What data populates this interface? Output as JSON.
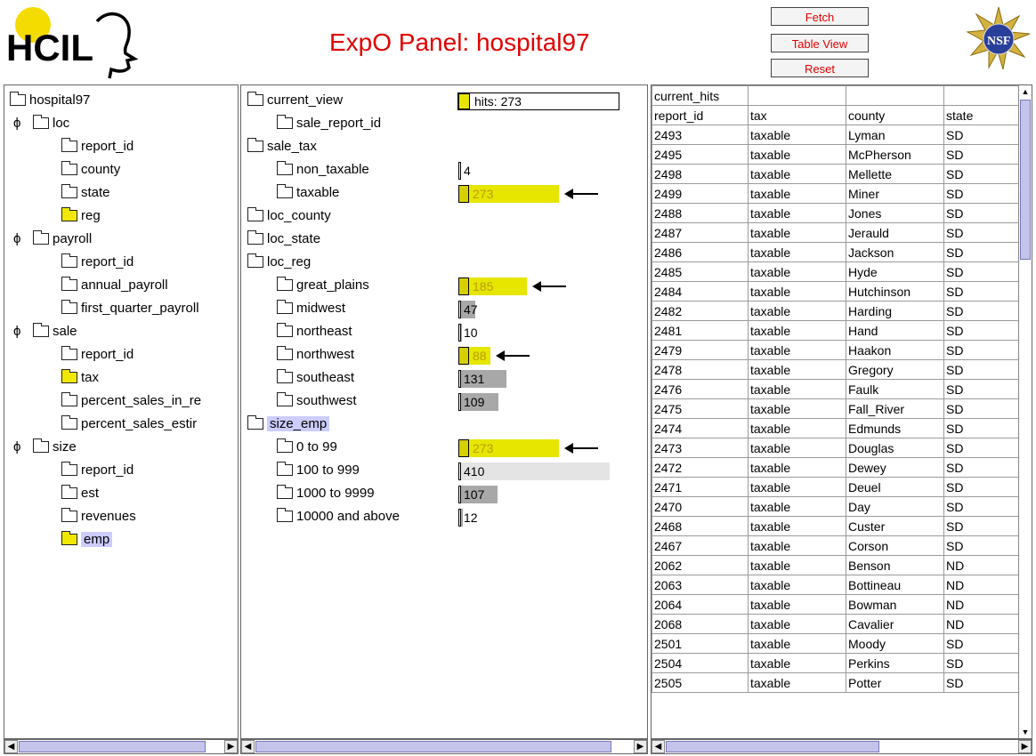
{
  "header": {
    "logo_text": "HCIL",
    "title": "ExpO Panel: hospital97",
    "buttons": [
      "Fetch",
      "Table View",
      "Reset"
    ],
    "nsf_text": "NSF"
  },
  "schema_tree": {
    "root": "hospital97",
    "items": [
      {
        "label": "hospital97",
        "level": 0,
        "key": false,
        "color": "white"
      },
      {
        "label": "loc",
        "level": 1,
        "key": true,
        "color": "white"
      },
      {
        "label": "report_id",
        "level": 2,
        "key": false,
        "color": "white"
      },
      {
        "label": "county",
        "level": 2,
        "key": false,
        "color": "white"
      },
      {
        "label": "state",
        "level": 2,
        "key": false,
        "color": "white"
      },
      {
        "label": "reg",
        "level": 2,
        "key": false,
        "color": "yellow"
      },
      {
        "label": "payroll",
        "level": 1,
        "key": true,
        "color": "white"
      },
      {
        "label": "report_id",
        "level": 2,
        "key": false,
        "color": "white"
      },
      {
        "label": "annual_payroll",
        "level": 2,
        "key": false,
        "color": "white"
      },
      {
        "label": "first_quarter_payroll",
        "level": 2,
        "key": false,
        "color": "white"
      },
      {
        "label": "sale",
        "level": 1,
        "key": true,
        "color": "white"
      },
      {
        "label": "report_id",
        "level": 2,
        "key": false,
        "color": "white"
      },
      {
        "label": "tax",
        "level": 2,
        "key": false,
        "color": "yellow"
      },
      {
        "label": "percent_sales_in_re",
        "level": 2,
        "key": false,
        "color": "white"
      },
      {
        "label": "percent_sales_estir",
        "level": 2,
        "key": false,
        "color": "white"
      },
      {
        "label": "size",
        "level": 1,
        "key": true,
        "color": "white"
      },
      {
        "label": "report_id",
        "level": 2,
        "key": false,
        "color": "white"
      },
      {
        "label": "est",
        "level": 2,
        "key": false,
        "color": "white"
      },
      {
        "label": "revenues",
        "level": 2,
        "key": false,
        "color": "white"
      },
      {
        "label": "emp",
        "level": 2,
        "key": false,
        "color": "yellow",
        "selected": true
      }
    ]
  },
  "view_tree": {
    "hits_label": "hits: 273",
    "items": [
      {
        "label": "current_view",
        "level": 0,
        "key": false
      },
      {
        "label": "sale_report_id",
        "level": 1,
        "key": false
      },
      {
        "label": "sale_tax",
        "level": 0,
        "key": true
      },
      {
        "label": "non_taxable",
        "level": 1,
        "key": false,
        "count": "4",
        "total": 4,
        "hit": 0,
        "arrow": false
      },
      {
        "label": "taxable",
        "level": 1,
        "key": false,
        "count": "273",
        "total": 273,
        "hit": 273,
        "arrow": true
      },
      {
        "label": "loc_county",
        "level": 0,
        "key": false
      },
      {
        "label": "loc_state",
        "level": 0,
        "key": false
      },
      {
        "label": "loc_reg",
        "level": 0,
        "key": true
      },
      {
        "label": "great_plains",
        "level": 1,
        "key": false,
        "count": "185",
        "total": 185,
        "hit": 185,
        "arrow": true
      },
      {
        "label": "midwest",
        "level": 1,
        "key": false,
        "count": "47",
        "total": 47,
        "hit": 0,
        "arrow": false
      },
      {
        "label": "northeast",
        "level": 1,
        "key": false,
        "count": "10",
        "total": 10,
        "hit": 0,
        "arrow": false
      },
      {
        "label": "northwest",
        "level": 1,
        "key": false,
        "count": "88",
        "total": 88,
        "hit": 88,
        "arrow": true
      },
      {
        "label": "southeast",
        "level": 1,
        "key": false,
        "count": "131",
        "total": 131,
        "hit": 0,
        "arrow": false
      },
      {
        "label": "southwest",
        "level": 1,
        "key": false,
        "count": "109",
        "total": 109,
        "hit": 0,
        "arrow": false
      },
      {
        "label": "size_emp",
        "level": 0,
        "key": true,
        "selected": true
      },
      {
        "label": "0 to 99",
        "level": 1,
        "key": false,
        "count": "273",
        "total": 273,
        "hit": 273,
        "arrow": true
      },
      {
        "label": "100 to 999",
        "level": 1,
        "key": false,
        "count": "410",
        "total": 410,
        "hit": 0,
        "arrow": false
      },
      {
        "label": "1000 to 9999",
        "level": 1,
        "key": false,
        "count": "107",
        "total": 107,
        "hit": 0,
        "arrow": false
      },
      {
        "label": "10000 and above",
        "level": 1,
        "key": false,
        "count": "12",
        "total": 12,
        "hit": 0,
        "arrow": false
      }
    ]
  },
  "results_table": {
    "group_header": [
      "current_hits",
      "",
      "",
      ""
    ],
    "columns": [
      "report_id",
      "tax",
      "county",
      "state"
    ],
    "rows": [
      [
        "2493",
        "taxable",
        "Lyman",
        "SD"
      ],
      [
        "2495",
        "taxable",
        "McPherson",
        "SD"
      ],
      [
        "2498",
        "taxable",
        "Mellette",
        "SD"
      ],
      [
        "2499",
        "taxable",
        "Miner",
        "SD"
      ],
      [
        "2488",
        "taxable",
        "Jones",
        "SD"
      ],
      [
        "2487",
        "taxable",
        "Jerauld",
        "SD"
      ],
      [
        "2486",
        "taxable",
        "Jackson",
        "SD"
      ],
      [
        "2485",
        "taxable",
        "Hyde",
        "SD"
      ],
      [
        "2484",
        "taxable",
        "Hutchinson",
        "SD"
      ],
      [
        "2482",
        "taxable",
        "Harding",
        "SD"
      ],
      [
        "2481",
        "taxable",
        "Hand",
        "SD"
      ],
      [
        "2479",
        "taxable",
        "Haakon",
        "SD"
      ],
      [
        "2478",
        "taxable",
        "Gregory",
        "SD"
      ],
      [
        "2476",
        "taxable",
        "Faulk",
        "SD"
      ],
      [
        "2475",
        "taxable",
        "Fall_River",
        "SD"
      ],
      [
        "2474",
        "taxable",
        "Edmunds",
        "SD"
      ],
      [
        "2473",
        "taxable",
        "Douglas",
        "SD"
      ],
      [
        "2472",
        "taxable",
        "Dewey",
        "SD"
      ],
      [
        "2471",
        "taxable",
        "Deuel",
        "SD"
      ],
      [
        "2470",
        "taxable",
        "Day",
        "SD"
      ],
      [
        "2468",
        "taxable",
        "Custer",
        "SD"
      ],
      [
        "2467",
        "taxable",
        "Corson",
        "SD"
      ],
      [
        "2062",
        "taxable",
        "Benson",
        "ND"
      ],
      [
        "2063",
        "taxable",
        "Bottineau",
        "ND"
      ],
      [
        "2064",
        "taxable",
        "Bowman",
        "ND"
      ],
      [
        "2068",
        "taxable",
        "Cavalier",
        "ND"
      ],
      [
        "2501",
        "taxable",
        "Moody",
        "SD"
      ],
      [
        "2504",
        "taxable",
        "Perkins",
        "SD"
      ],
      [
        "2505",
        "taxable",
        "Potter",
        "SD"
      ]
    ]
  },
  "colors": {
    "title": "#e00000",
    "hit_bar": "#e6e600",
    "hit_text": "#b8a000",
    "gray_bar": "#a8a8a8",
    "selection": "#ccccff",
    "scroll_thumb": "#c4c4ea"
  }
}
